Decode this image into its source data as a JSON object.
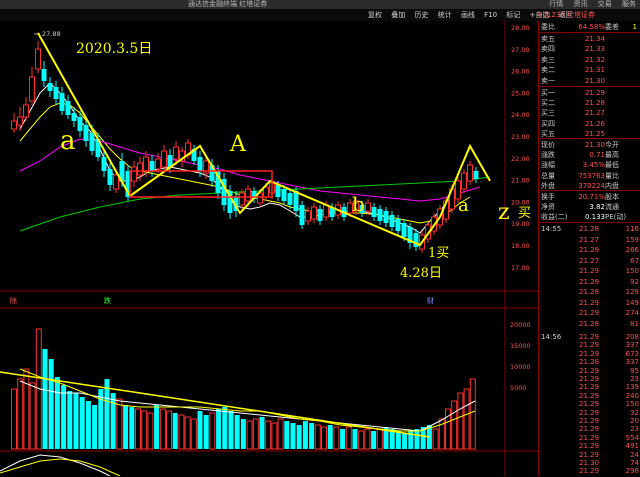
{
  "window": {
    "title": "通达信金融终端 红塔证券",
    "controls": [
      "行情",
      "资讯",
      "交易",
      "服务"
    ]
  },
  "toolbar": {
    "items": [
      "复权",
      "叠加",
      "历史",
      "统计",
      "画线",
      "F10",
      "标记",
      "+自选",
      "返回"
    ]
  },
  "stock": {
    "code": "601236",
    "name": "红塔证券"
  },
  "chart": {
    "max_label": "27.88",
    "price_axis": [
      "28.00",
      "27.00",
      "26.00",
      "25.00",
      "24.00",
      "23.00",
      "22.00",
      "21.00",
      "20.00",
      "19.00",
      "18.00",
      "17.00"
    ],
    "volume_axis": [
      "20000",
      "15000",
      "10000",
      "5000"
    ],
    "markers": {
      "a": "a",
      "A": "A",
      "b": "b",
      "a2": "a",
      "z": "z",
      "buy": "买"
    },
    "annotations": {
      "date1": "2020.3.5日",
      "buy1": "1买",
      "date2": "4.28日"
    },
    "flags": {
      "f1": "除",
      "f2": "跌",
      "f3": "财"
    },
    "colors": {
      "up": "#ff3030",
      "down": "#00ffff",
      "ma1": "#ffffff",
      "ma2": "#ffff00",
      "ma3": "#ff00ff",
      "ma4": "#00cc00",
      "hand": "#ffff00"
    }
  },
  "quote": {
    "commission": {
      "label": "委比",
      "val": "64.58%",
      "label2": "委差",
      "vol": "1"
    },
    "asks": [
      {
        "label": "卖五",
        "price": "21.34"
      },
      {
        "label": "卖四",
        "price": "21.33"
      },
      {
        "label": "卖三",
        "price": "21.32"
      },
      {
        "label": "卖二",
        "price": "21.31"
      },
      {
        "label": "卖一",
        "price": "21.30"
      }
    ],
    "bids": [
      {
        "label": "买一",
        "price": "21.29"
      },
      {
        "label": "买二",
        "price": "21.28"
      },
      {
        "label": "买三",
        "price": "21.27"
      },
      {
        "label": "买四",
        "price": "21.26"
      },
      {
        "label": "买五",
        "price": "21.25"
      }
    ],
    "stats": [
      {
        "label": "现价",
        "val": "21.30",
        "label2": "今开"
      },
      {
        "label": "涨跌",
        "val": "0.71",
        "label2": "最高"
      },
      {
        "label": "涨幅",
        "val": "3.45%",
        "label2": "最低"
      },
      {
        "label": "总量",
        "val": "753763",
        "label2": "量比"
      },
      {
        "label": "外盘",
        "val": "370224",
        "label2": "内盘"
      }
    ],
    "stats2": [
      {
        "label": "换手",
        "val": "20.71%",
        "label2": "股本"
      },
      {
        "label": "净资",
        "val": "3.82",
        "label2": "流通"
      },
      {
        "label": "收益(二)",
        "val": "0.133",
        "label2": "PE(动)"
      }
    ]
  },
  "ticks1": {
    "time": "14:55",
    "rows": [
      {
        "p": "21.28",
        "v": "116"
      },
      {
        "p": "21.27",
        "v": "159"
      },
      {
        "p": "21.29",
        "v": "266"
      },
      {
        "p": "21.27",
        "v": "67"
      },
      {
        "p": "21.29",
        "v": "150"
      },
      {
        "p": "21.29",
        "v": "92"
      },
      {
        "p": "21.28",
        "v": "129"
      },
      {
        "p": "21.29",
        "v": "149"
      },
      {
        "p": "21.29",
        "v": "274"
      },
      {
        "p": "21.28",
        "v": "81"
      }
    ]
  },
  "ticks2": {
    "time": "14:56",
    "rows": [
      {
        "p": "21.29",
        "v": "208"
      },
      {
        "p": "21.29",
        "v": "337"
      },
      {
        "p": "21.29",
        "v": "673"
      },
      {
        "p": "21.28",
        "v": "337"
      },
      {
        "p": "21.29",
        "v": "95"
      },
      {
        "p": "21.29",
        "v": "23"
      },
      {
        "p": "21.29",
        "v": "139"
      },
      {
        "p": "21.29",
        "v": "240"
      },
      {
        "p": "21.29",
        "v": "150"
      },
      {
        "p": "21.29",
        "v": "32"
      },
      {
        "p": "21.29",
        "v": "20"
      },
      {
        "p": "21.29",
        "v": "23"
      },
      {
        "p": "21.29",
        "v": "554"
      },
      {
        "p": "21.29",
        "v": "491"
      },
      {
        "p": "21.29",
        "v": "24"
      },
      {
        "p": "21.30",
        "v": "74"
      },
      {
        "p": "21.29",
        "v": "298"
      }
    ]
  }
}
